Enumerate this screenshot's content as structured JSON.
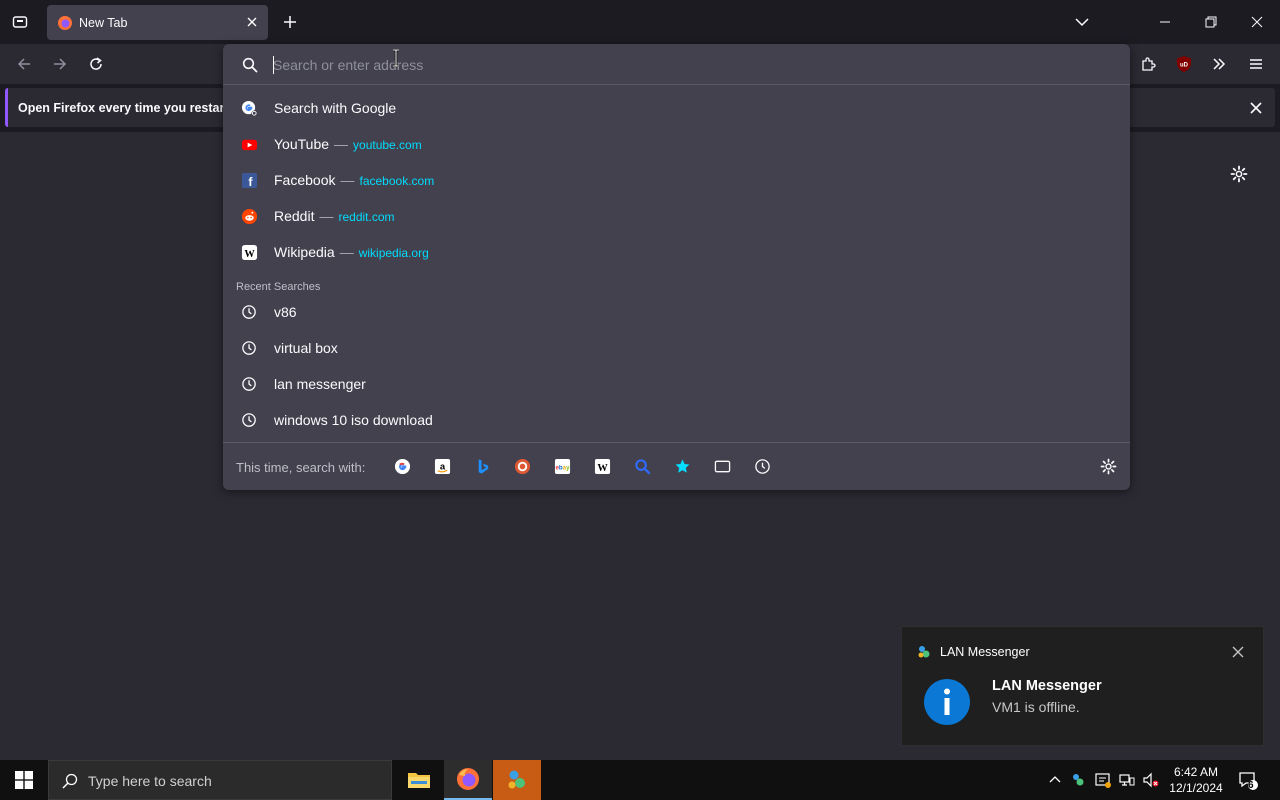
{
  "tab": {
    "title": "New Tab"
  },
  "urlbar": {
    "placeholder": "Search or enter address",
    "value": ""
  },
  "notification": {
    "message": "Open Firefox every time you restart y"
  },
  "suggestions": {
    "search_google": "Search with Google",
    "sites": [
      {
        "name": "YouTube",
        "dash": "—",
        "url": "youtube.com",
        "icon": "youtube-icon"
      },
      {
        "name": "Facebook",
        "dash": "—",
        "url": "facebook.com",
        "icon": "facebook-icon"
      },
      {
        "name": "Reddit",
        "dash": "—",
        "url": "reddit.com",
        "icon": "reddit-icon"
      },
      {
        "name": "Wikipedia",
        "dash": "—",
        "url": "wikipedia.org",
        "icon": "wikipedia-icon"
      }
    ],
    "recent_title": "Recent Searches",
    "recent": [
      "v86",
      "virtual box",
      "lan messenger",
      "windows 10 iso download"
    ]
  },
  "search_with": {
    "label": "This time, search with:",
    "engines": [
      "google-icon",
      "amazon-icon",
      "bing-icon",
      "duckduckgo-icon",
      "ebay-icon",
      "wikipedia-icon",
      "search-icon",
      "bookmarks-star-icon",
      "tabs-icon",
      "history-icon"
    ]
  },
  "toast": {
    "app": "LAN Messenger",
    "title": "LAN Messenger",
    "body": "VM1 is offline."
  },
  "taskbar": {
    "search_placeholder": "Type here to search",
    "time": "6:42 AM",
    "date": "12/1/2024",
    "notifications_count": "6"
  },
  "colors": {
    "accent": "#00ddff",
    "firefox_purple": "#9059ff",
    "toast_icon": "#0a78d4",
    "active_app": "#c95c14"
  }
}
